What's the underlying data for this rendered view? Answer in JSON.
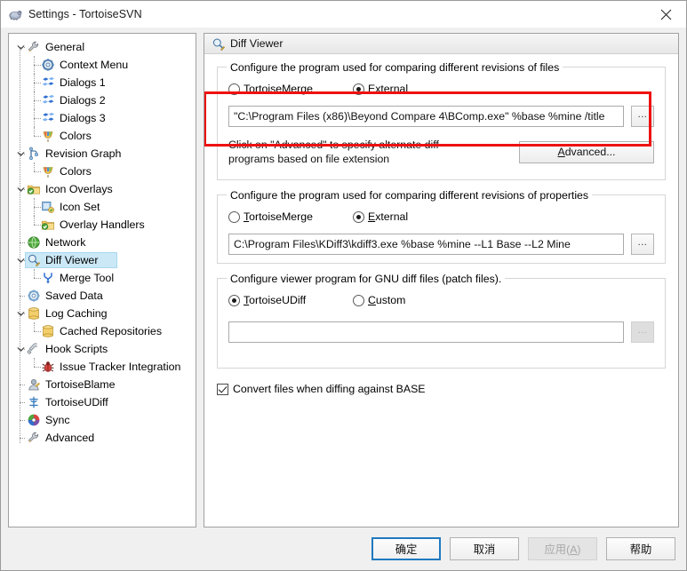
{
  "window": {
    "title": "Settings - TortoiseSVN",
    "icon": "tortoisesvn-icon",
    "close_label": "✕"
  },
  "sidebar": {
    "items": [
      {
        "label": "General",
        "level": 0,
        "twisty": "expanded",
        "icon": "wrench-icon",
        "selected": false
      },
      {
        "label": "Context Menu",
        "level": 1,
        "twisty": "none",
        "icon": "gear-icon",
        "selected": false
      },
      {
        "label": "Dialogs 1",
        "level": 1,
        "twisty": "none",
        "icon": "dialogs-icon",
        "selected": false
      },
      {
        "label": "Dialogs 2",
        "level": 1,
        "twisty": "none",
        "icon": "dialogs-icon",
        "selected": false
      },
      {
        "label": "Dialogs 3",
        "level": 1,
        "twisty": "none",
        "icon": "dialogs-icon",
        "selected": false
      },
      {
        "label": "Colors",
        "level": 1,
        "twisty": "none",
        "icon": "palette-icon",
        "selected": false
      },
      {
        "label": "Revision Graph",
        "level": 0,
        "twisty": "expanded",
        "icon": "graph-icon",
        "selected": false
      },
      {
        "label": "Colors",
        "level": 1,
        "twisty": "none",
        "icon": "palette-icon",
        "selected": false
      },
      {
        "label": "Icon Overlays",
        "level": 0,
        "twisty": "expanded",
        "icon": "folder-green-icon",
        "selected": false
      },
      {
        "label": "Icon Set",
        "level": 1,
        "twisty": "none",
        "icon": "iconset-icon",
        "selected": false
      },
      {
        "label": "Overlay Handlers",
        "level": 1,
        "twisty": "none",
        "icon": "folder-green-icon",
        "selected": false
      },
      {
        "label": "Network",
        "level": 0,
        "twisty": "none",
        "icon": "globe-icon",
        "selected": false
      },
      {
        "label": "Diff Viewer",
        "level": 0,
        "twisty": "expanded",
        "icon": "magnifier-icon",
        "selected": true
      },
      {
        "label": "Merge Tool",
        "level": 1,
        "twisty": "none",
        "icon": "merge-icon",
        "selected": false
      },
      {
        "label": "Saved Data",
        "level": 0,
        "twisty": "none",
        "icon": "gear-blue-icon",
        "selected": false
      },
      {
        "label": "Log Caching",
        "level": 0,
        "twisty": "expanded",
        "icon": "database-icon",
        "selected": false
      },
      {
        "label": "Cached Repositories",
        "level": 1,
        "twisty": "none",
        "icon": "database-icon",
        "selected": false
      },
      {
        "label": "Hook Scripts",
        "level": 0,
        "twisty": "expanded",
        "icon": "hook-icon",
        "selected": false
      },
      {
        "label": "Issue Tracker Integration",
        "level": 1,
        "twisty": "none",
        "icon": "bug-icon",
        "selected": false
      },
      {
        "label": "TortoiseBlame",
        "level": 0,
        "twisty": "none",
        "icon": "blame-icon",
        "selected": false
      },
      {
        "label": "TortoiseUDiff",
        "level": 0,
        "twisty": "none",
        "icon": "udiff-icon",
        "selected": false
      },
      {
        "label": "Sync",
        "level": 0,
        "twisty": "none",
        "icon": "sync-icon",
        "selected": false
      },
      {
        "label": "Advanced",
        "level": 0,
        "twisty": "none",
        "icon": "wrench-icon",
        "selected": false
      }
    ]
  },
  "panel": {
    "title": "Diff Viewer",
    "icon": "magnifier-icon"
  },
  "files_group": {
    "legend": "Configure the program used for comparing different revisions of files",
    "radio_tortoisemerge": "TortoiseMerge",
    "radio_tortoisemerge_accel": "T",
    "radio_external": "External",
    "radio_external_accel": "E",
    "selected": "external",
    "path_value": "\"C:\\Program Files (x86)\\Beyond Compare 4\\BComp.exe\" %base %mine /title",
    "browse_label": "...",
    "advanced_text_line1": "Click on \"Advanced\" to specify alternate diff",
    "advanced_text_line2": "programs based on file extension",
    "advanced_button": "Advanced...",
    "advanced_button_accel": "A"
  },
  "props_group": {
    "legend": "Configure the program used for comparing different revisions of properties",
    "radio_tortoisemerge": "TortoiseMerge",
    "radio_tortoisemerge_accel": "T",
    "radio_external": "External",
    "radio_external_accel": "E",
    "selected": "external",
    "path_value": "C:\\Program Files\\KDiff3\\kdiff3.exe %base %mine  --L1 Base --L2 Mine",
    "browse_label": "..."
  },
  "patch_group": {
    "legend": "Configure viewer program for GNU diff files (patch files).",
    "radio_udiff": "TortoiseUDiff",
    "radio_udiff_accel": "T",
    "radio_custom": "Custom",
    "radio_custom_accel": "C",
    "selected": "udiff",
    "path_value": "",
    "browse_label": "..."
  },
  "convert_checkbox": {
    "label": "Convert files when diffing against BASE",
    "accel": "C",
    "checked": true
  },
  "footer": {
    "ok": "确定",
    "cancel": "取消",
    "apply": "应用(A)",
    "apply_accel": "A",
    "help": "帮助",
    "apply_disabled": true
  },
  "annotation": {
    "color": "#ee1111",
    "shape": "rectangle-highlight"
  }
}
